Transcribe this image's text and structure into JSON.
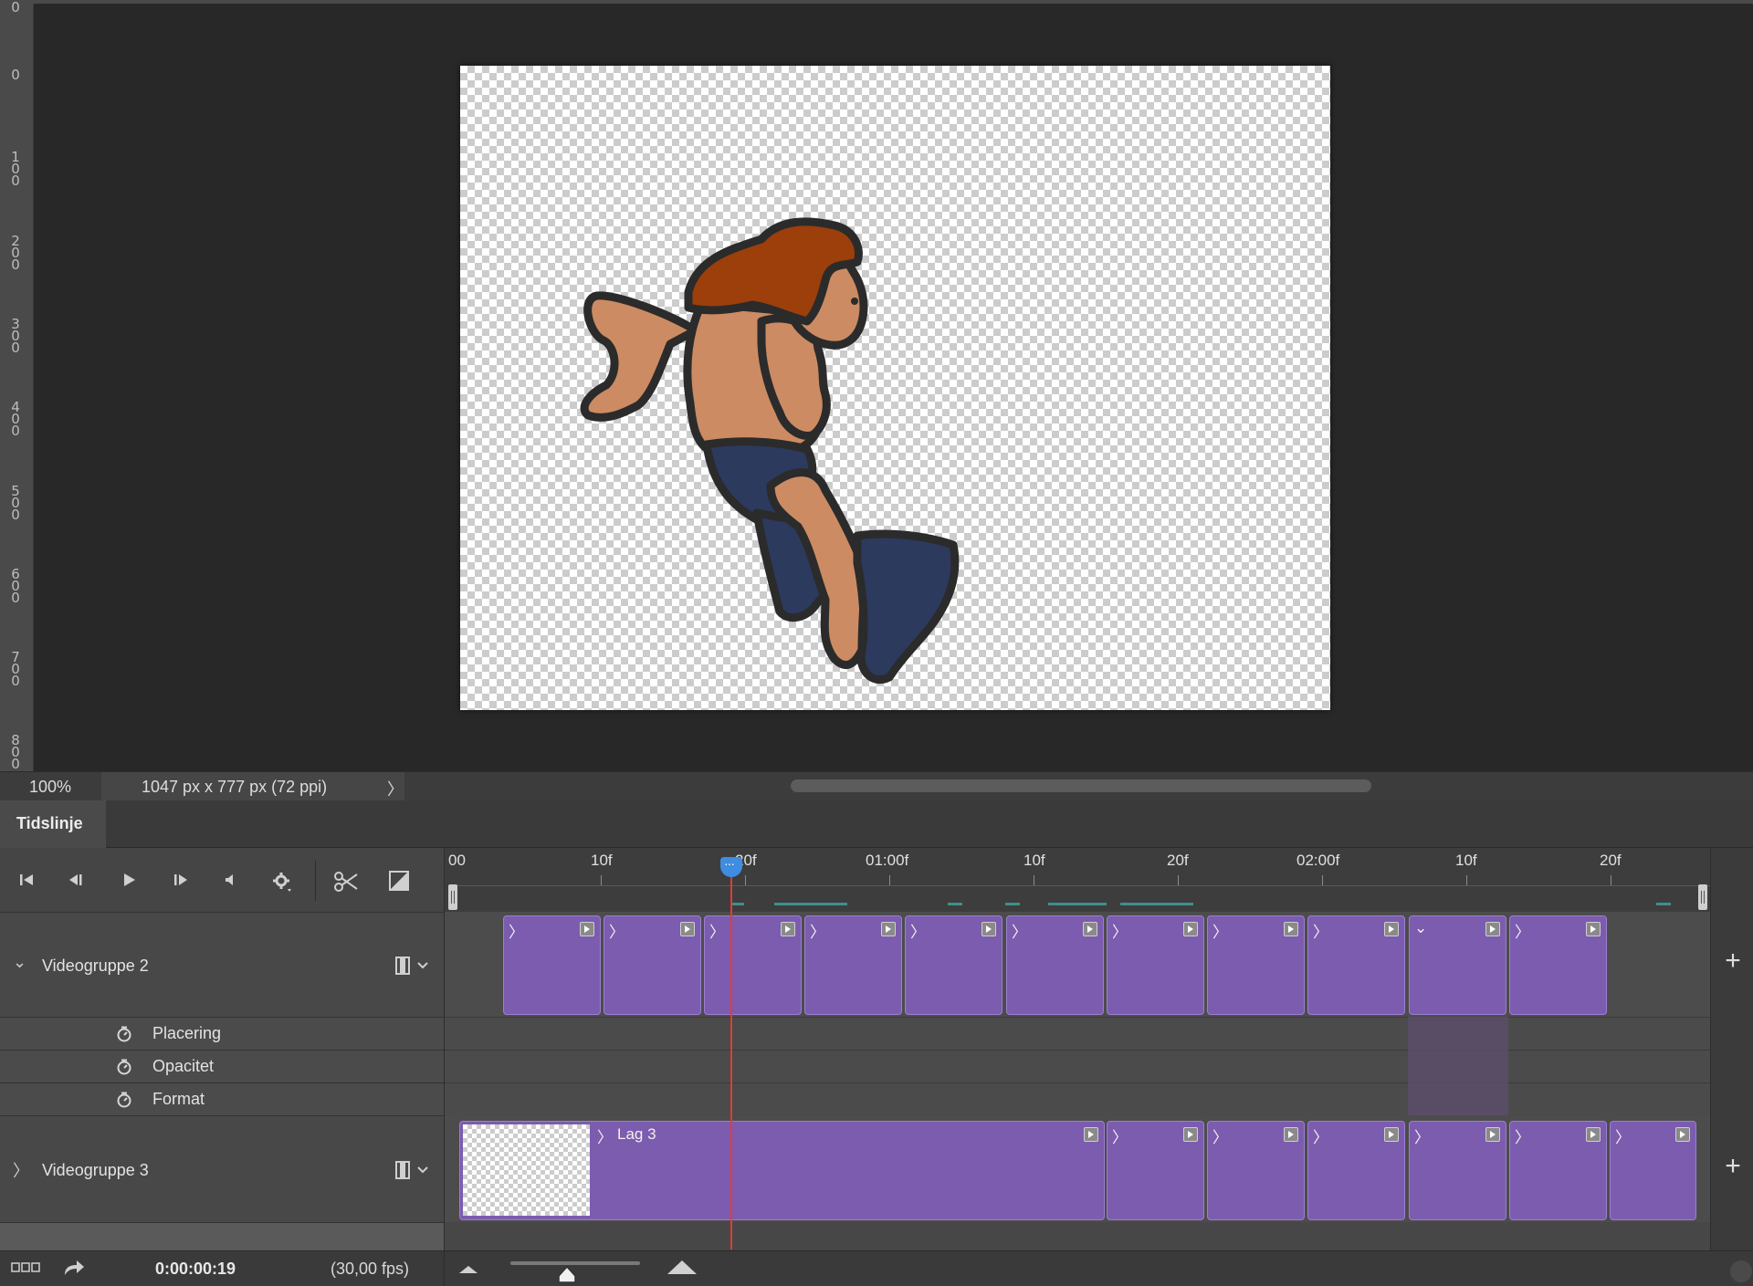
{
  "ruler": {
    "labels": [
      "0",
      "0",
      "100",
      "200",
      "300",
      "400",
      "500",
      "600",
      "700",
      "800"
    ]
  },
  "status": {
    "zoom": "100%",
    "doc_info": "1047 px x 777 px (72 ppi)",
    "arrow": "〉"
  },
  "panel": {
    "tab": "Tidslinje"
  },
  "timeline": {
    "ruler_labels": [
      "00",
      "10f",
      "20f",
      "01:00f",
      "10f",
      "20f",
      "02:00f",
      "10f",
      "20f"
    ],
    "playhead_label": "···",
    "groups": [
      {
        "name": "Videogruppe 2",
        "expanded": true,
        "chevron": "⌄"
      },
      {
        "name": "Videogruppe 3",
        "expanded": false,
        "chevron": "〉"
      }
    ],
    "properties": [
      "Placering",
      "Opacitet",
      "Format"
    ],
    "layer_name": "Lag 3",
    "clip_chevron": "〉",
    "clip_chevron_down": "⌄",
    "add_label": "+"
  },
  "footer": {
    "timecode": "0:00:00:19",
    "fps": "(30,00 fps)"
  },
  "colors": {
    "clip": "#7c5caf",
    "playhead": "#3f8de0",
    "playhead_line": "#e23a3a"
  }
}
